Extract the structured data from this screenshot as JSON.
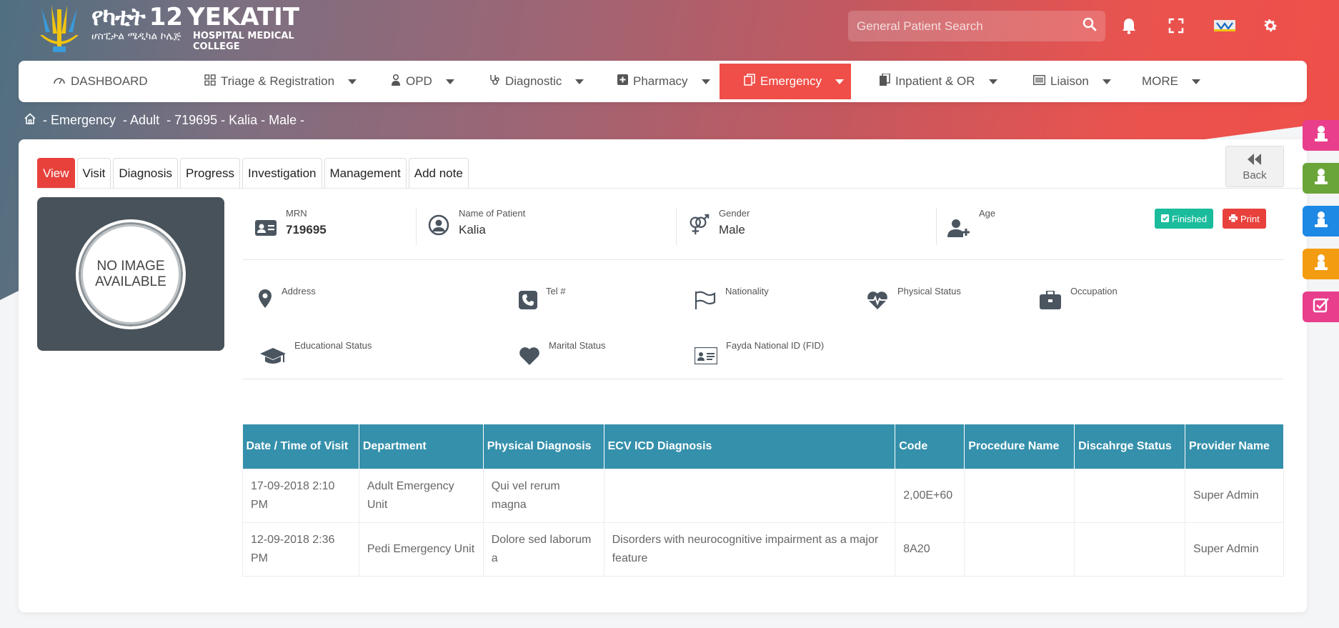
{
  "header": {
    "logo_amharic": "የካቲት",
    "logo_number": "12",
    "logo_english": "YEKATIT",
    "logo_amharic_sub": "ሆስፒታል ሜዲካል ኮሌጅ",
    "logo_sub_line1": "HOSPITAL MEDICAL",
    "logo_sub_line2": "COLLEGE",
    "search_placeholder": "General Patient Search",
    "icons": [
      "search-icon",
      "bell-icon",
      "fullscreen-icon",
      "flag-icon",
      "gear-icon"
    ]
  },
  "nav": {
    "items": [
      {
        "label": "DASHBOARD",
        "icon": "dashboard-icon"
      },
      {
        "label": "Triage & Registration",
        "icon": "grid-icon"
      },
      {
        "label": "OPD",
        "icon": "doctor-icon"
      },
      {
        "label": "Diagnostic",
        "icon": "stethoscope-icon"
      },
      {
        "label": "Pharmacy",
        "icon": "plus-square-icon"
      },
      {
        "label": "Emergency",
        "icon": "copy-icon"
      },
      {
        "label": "Inpatient & OR",
        "icon": "files-icon"
      },
      {
        "label": "Liaison",
        "icon": "list-icon"
      },
      {
        "label": "MORE",
        "icon": ""
      }
    ],
    "active": "Emergency"
  },
  "breadcrumb": {
    "part1": "- Emergency",
    "part2": "- Adult",
    "part3": "- 719695 - Kalia - Male -"
  },
  "tabs": [
    "View",
    "Visit",
    "Diagnosis",
    "Progress",
    "Investigation",
    "Management",
    "Add note"
  ],
  "back_label": "Back",
  "photo_text_1": "NO IMAGE",
  "photo_text_2": "AVAILABLE",
  "patient": {
    "mrn_label": "MRN",
    "mrn": "719695",
    "name_label": "Name of Patient",
    "name": "Kalia",
    "gender_label": "Gender",
    "gender": "Male",
    "age_label": "Age",
    "age": ""
  },
  "badges": {
    "finished": "Finished",
    "print": "Print"
  },
  "details": {
    "address": "Address",
    "tel": "Tel #",
    "nationality": "Nationality",
    "physical_status": "Physical Status",
    "occupation": "Occupation",
    "educational_status": "Educational Status",
    "marital_status": "Marital Status",
    "fayda_id": "Fayda National ID (FID)"
  },
  "table": {
    "headers": [
      "Date / Time of Visit",
      "Department",
      "Physical Diagnosis",
      "ECV ICD Diagnosis",
      "Code",
      "Procedure Name",
      "Discahrge Status",
      "Provider Name"
    ],
    "rows": [
      [
        "17-09-2018 2:10 PM",
        "Adult Emergency Unit",
        "Qui vel rerum magna",
        "",
        "2,00E+60",
        "",
        "",
        "Super Admin"
      ],
      [
        "12-09-2018 2:36 PM",
        "Pedi Emergency Unit",
        "Dolore sed laborum a",
        "Disorders with neurocognitive impairment as a major feature",
        "8A20",
        "",
        "",
        "Super Admin"
      ]
    ]
  },
  "colors": {
    "accent_red": "#f04e48",
    "table_header": "#3590ab",
    "finished_green": "#1abc9c",
    "print_red": "#e8413c"
  },
  "side_buttons": [
    {
      "color": "#e83e8c",
      "icon": "user-icon"
    },
    {
      "color": "#6aa539",
      "icon": "user-icon"
    },
    {
      "color": "#1e88e5",
      "icon": "user-icon"
    },
    {
      "color": "#f39c12",
      "icon": "user-icon"
    },
    {
      "color": "#e83e8c",
      "icon": "check-square-icon"
    }
  ]
}
